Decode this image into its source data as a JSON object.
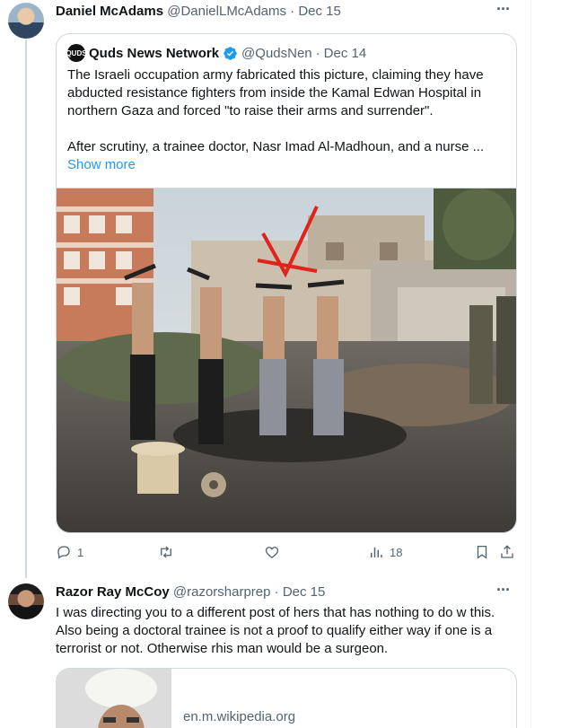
{
  "tweet1": {
    "author_name": "Daniel McAdams",
    "handle": "@DanielLMcAdams",
    "date": "Dec 15",
    "more_icon": "more-dots-icon"
  },
  "quote": {
    "source_name": "Quds News Network",
    "source_logo_text": "QUDS",
    "handle": "@QudsNen",
    "date": "Dec 14",
    "text_p1": "The Israeli occupation army fabricated this picture, claiming they have abducted resistance fighters from inside the Kamal Edwan Hospital in northern Gaza and forced \"to raise their arms and surrender\".",
    "text_p2": "After scrutiny, a trainee doctor, Nasr Imad Al-Madhoun, and a nurse ...",
    "show_more": "Show more",
    "verified_color": "#1d9bf0"
  },
  "actions": {
    "replies": "1",
    "retweets": "",
    "likes": "",
    "views": "18",
    "icons": [
      "reply-icon",
      "retweet-icon",
      "like-icon",
      "views-icon",
      "bookmark-icon",
      "share-icon"
    ]
  },
  "tweet2": {
    "author_name": "Razor Ray McCoy",
    "handle": "@razorsharprep",
    "date": "Dec 15",
    "text": "I was directing you to a different post of hers that has nothing to do w this. Also being a doctoral trainee is not a proof to qualify either way if one is a terrorist or not. Otherwise rhis man would be a surgeon.",
    "link_domain": "en.m.wikipedia.org"
  },
  "colors": {
    "text": "#0f1419",
    "secondary": "#536471",
    "link": "#1d9bf0",
    "border": "#cfd9de"
  }
}
